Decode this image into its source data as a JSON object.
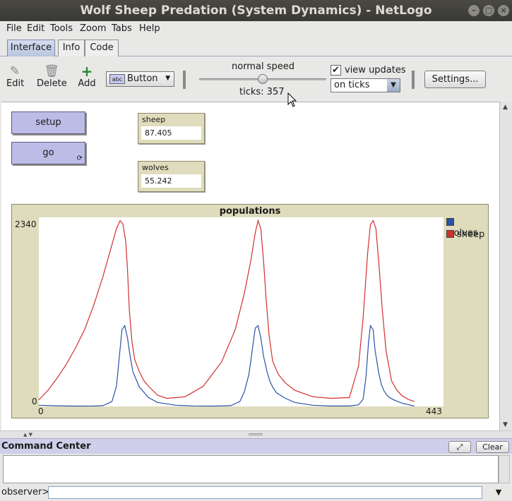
{
  "window": {
    "title": "Wolf Sheep Predation (System Dynamics) - NetLogo"
  },
  "menu": [
    "File",
    "Edit",
    "Tools",
    "Zoom",
    "Tabs",
    "Help"
  ],
  "tabs": [
    "Interface",
    "Info",
    "Code"
  ],
  "toolbar": {
    "edit_label": "Edit",
    "delete_label": "Delete",
    "add_label": "Add",
    "widget_type": "Button",
    "widget_icon_text": "abc",
    "speed_label": "normal speed",
    "speed_fraction": 0.5,
    "ticks_text": "ticks: 357",
    "view_updates_label": "view updates",
    "view_updates_checked": true,
    "update_mode": "on ticks",
    "settings_label": "Settings..."
  },
  "buttons": {
    "setup": "setup",
    "go": "go",
    "go_forever_glyph": "⟳"
  },
  "monitors": [
    {
      "label": "sheep",
      "value": "87.405"
    },
    {
      "label": "wolves",
      "value": "55.242"
    }
  ],
  "chart_data": {
    "type": "line",
    "title": "populations",
    "xlim": [
      0,
      443
    ],
    "ylim": [
      0,
      2340
    ],
    "x_tick_labels": [
      "0",
      "443"
    ],
    "y_tick_labels": [
      "0",
      "2340"
    ],
    "legend_position": "top-right",
    "series": [
      {
        "name": "wolves",
        "color": "#2953a6",
        "x": [
          0,
          20,
          40,
          60,
          70,
          80,
          85,
          88,
          91,
          94,
          97,
          100,
          103,
          110,
          120,
          130,
          150,
          170,
          190,
          210,
          220,
          225,
          230,
          237,
          240,
          243,
          246,
          250,
          253,
          256,
          260,
          270,
          280,
          300,
          320,
          340,
          350,
          355,
          358,
          361,
          363,
          366,
          368,
          372,
          375,
          378,
          381,
          384,
          388,
          393,
          398,
          403,
          408,
          411
        ],
        "y": [
          15,
          8,
          4,
          5,
          10,
          60,
          250,
          600,
          950,
          1000,
          850,
          620,
          430,
          240,
          110,
          50,
          15,
          6,
          4,
          10,
          60,
          180,
          400,
          970,
          1000,
          850,
          620,
          420,
          310,
          240,
          170,
          100,
          50,
          15,
          5,
          5,
          20,
          90,
          350,
          800,
          1000,
          950,
          700,
          420,
          270,
          190,
          140,
          110,
          85,
          60,
          40,
          25,
          12,
          5
        ]
      },
      {
        "name": "sheep",
        "color": "#d13030",
        "x": [
          0,
          10,
          20,
          30,
          40,
          50,
          60,
          70,
          80,
          85,
          89,
          92,
          95,
          97,
          99,
          102,
          105,
          110,
          115,
          120,
          130,
          140,
          160,
          180,
          200,
          215,
          225,
          232,
          237,
          240,
          243,
          246,
          249,
          252,
          256,
          262,
          270,
          280,
          300,
          320,
          340,
          350,
          355,
          360,
          363,
          366,
          369,
          372,
          376,
          380,
          386,
          392,
          398,
          404,
          411
        ],
        "y": [
          80,
          200,
          350,
          520,
          720,
          950,
          1250,
          1600,
          2000,
          2200,
          2300,
          2260,
          2050,
          1700,
          1200,
          800,
          580,
          430,
          320,
          250,
          140,
          100,
          120,
          250,
          550,
          950,
          1400,
          1800,
          2150,
          2300,
          2200,
          1800,
          1300,
          880,
          560,
          400,
          290,
          200,
          120,
          100,
          110,
          500,
          1100,
          1900,
          2250,
          2300,
          2200,
          1800,
          1200,
          700,
          320,
          200,
          130,
          90,
          60
        ]
      }
    ]
  },
  "command_center": {
    "title": "Command Center",
    "clear_label": "Clear",
    "expand_glyph": "⤢",
    "prompt": "observer>"
  }
}
